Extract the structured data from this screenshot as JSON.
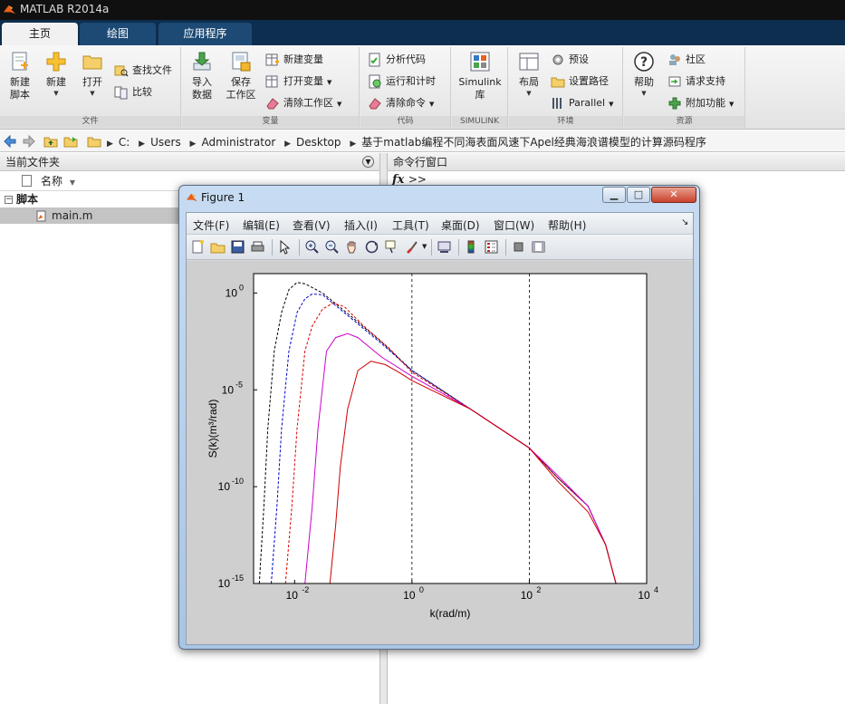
{
  "window": {
    "title": "MATLAB R2014a"
  },
  "tabs": [
    {
      "label": "主页",
      "active": true
    },
    {
      "label": "绘图",
      "active": false
    },
    {
      "label": "应用程序",
      "active": false
    }
  ],
  "ribbon": {
    "file": {
      "caption": "文件",
      "new_script": "新建\n脚本",
      "new_script_l1": "新建",
      "new_script_l2": "脚本",
      "new": "新建",
      "open": "打开",
      "find_files": "查找文件",
      "compare": "比较"
    },
    "variable": {
      "caption": "变量",
      "import_l1": "导入",
      "import_l2": "数据",
      "save_l1": "保存",
      "save_l2": "工作区",
      "new_variable": "新建变量",
      "open_variable": "打开变量",
      "clear_workspace": "清除工作区"
    },
    "code": {
      "caption": "代码",
      "analyze": "分析代码",
      "run_time": "运行和计时",
      "clear_commands": "清除命令"
    },
    "simulink": {
      "caption": "SIMULINK",
      "lib_l1": "Simulink",
      "lib_l2": "库"
    },
    "environment": {
      "caption": "环境",
      "layout": "布局",
      "preferences": "预设",
      "set_path": "设置路径",
      "parallel": "Parallel"
    },
    "resources": {
      "caption": "资源",
      "help": "帮助",
      "community": "社区",
      "support": "请求支持",
      "addons": "附加功能"
    }
  },
  "address": {
    "crumbs": [
      "C:",
      "Users",
      "Administrator",
      "Desktop",
      "基于matlab编程不同海表面风速下Apel经典海浪谱模型的计算源码程序"
    ]
  },
  "current_folder": {
    "title": "当前文件夹",
    "col_name": "名称",
    "group": "脚本",
    "file": "main.m"
  },
  "command_window": {
    "title": "命令行窗口",
    "prompt_fx": "fx",
    "prompt": ">>"
  },
  "figure": {
    "title": "Figure 1",
    "menu": [
      "文件(F)",
      "编辑(E)",
      "查看(V)",
      "插入(I)",
      "工具(T)",
      "桌面(D)",
      "窗口(W)",
      "帮助(H)"
    ]
  },
  "chart_data": {
    "type": "line",
    "title": "",
    "xlabel": "k(rad/m)",
    "ylabel": "S(k)(m³/rad)",
    "xscale": "log",
    "yscale": "log",
    "xlim": [
      0.002,
      10000
    ],
    "ylim": [
      1e-15,
      10
    ],
    "x_ticks": [
      {
        "v": 0.01,
        "label": "10",
        "exp": "-2"
      },
      {
        "v": 1,
        "label": "10",
        "exp": "0"
      },
      {
        "v": 100,
        "label": "10",
        "exp": "2"
      },
      {
        "v": 10000,
        "label": "10",
        "exp": "4"
      }
    ],
    "y_ticks": [
      {
        "v": 1e-15,
        "label": "10",
        "exp": "-15"
      },
      {
        "v": 1e-10,
        "label": "10",
        "exp": "-10"
      },
      {
        "v": 1e-05,
        "label": "10",
        "exp": "-5"
      },
      {
        "v": 1,
        "label": "10",
        "exp": "0"
      }
    ],
    "grid": "vertical dashed at x major ticks",
    "series": [
      {
        "color": "#000000",
        "style": "dashed",
        "points": [
          [
            0.0025,
            1e-15
          ],
          [
            0.003,
            1e-11
          ],
          [
            0.0035,
            1e-07
          ],
          [
            0.0045,
            0.001
          ],
          [
            0.006,
            0.1
          ],
          [
            0.008,
            1.5
          ],
          [
            0.011,
            3.5
          ],
          [
            0.015,
            3
          ],
          [
            0.03,
            1
          ],
          [
            0.1,
            0.05
          ],
          [
            0.3,
            0.003
          ],
          [
            1,
            0.0001
          ],
          [
            10,
            1e-06
          ],
          [
            100,
            1e-08
          ],
          [
            300,
            3e-10
          ],
          [
            1000,
            1e-11
          ],
          [
            2000,
            1e-13
          ],
          [
            3000,
            1e-15
          ]
        ]
      },
      {
        "color": "#0000cc",
        "style": "dashed",
        "points": [
          [
            0.004,
            1e-15
          ],
          [
            0.005,
            1e-11
          ],
          [
            0.006,
            1e-07
          ],
          [
            0.008,
            0.001
          ],
          [
            0.011,
            0.1
          ],
          [
            0.015,
            0.5
          ],
          [
            0.02,
            0.9
          ],
          [
            0.03,
            0.8
          ],
          [
            0.1,
            0.04
          ],
          [
            0.3,
            0.0025
          ],
          [
            1,
            0.0001
          ],
          [
            10,
            1e-06
          ],
          [
            100,
            1e-08
          ],
          [
            300,
            3e-10
          ],
          [
            1000,
            1e-11
          ],
          [
            2000,
            1e-13
          ],
          [
            3000,
            1e-15
          ]
        ]
      },
      {
        "color": "#dd0000",
        "style": "dashed",
        "points": [
          [
            0.007,
            1e-15
          ],
          [
            0.009,
            1e-11
          ],
          [
            0.011,
            1e-07
          ],
          [
            0.015,
            0.001
          ],
          [
            0.02,
            0.02
          ],
          [
            0.03,
            0.15
          ],
          [
            0.045,
            0.3
          ],
          [
            0.07,
            0.2
          ],
          [
            0.15,
            0.02
          ],
          [
            0.4,
            0.0015
          ],
          [
            1,
            8e-05
          ],
          [
            10,
            1e-06
          ],
          [
            100,
            1e-08
          ],
          [
            300,
            3e-10
          ],
          [
            1000,
            1e-11
          ],
          [
            2000,
            1e-13
          ],
          [
            3000,
            1e-15
          ]
        ]
      },
      {
        "color": "#cc00cc",
        "style": "solid",
        "points": [
          [
            0.015,
            1e-15
          ],
          [
            0.02,
            1e-11
          ],
          [
            0.025,
            1e-07
          ],
          [
            0.035,
            0.001
          ],
          [
            0.05,
            0.005
          ],
          [
            0.08,
            0.008
          ],
          [
            0.12,
            0.005
          ],
          [
            0.3,
            0.0005
          ],
          [
            1,
            5e-05
          ],
          [
            10,
            1e-06
          ],
          [
            100,
            1e-08
          ],
          [
            300,
            4e-10
          ],
          [
            1000,
            1e-11
          ],
          [
            2000,
            1e-13
          ],
          [
            3000,
            1e-15
          ]
        ]
      },
      {
        "color": "#cc0000",
        "style": "solid",
        "points": [
          [
            0.04,
            1e-15
          ],
          [
            0.05,
            1e-12
          ],
          [
            0.06,
            1e-09
          ],
          [
            0.08,
            1e-06
          ],
          [
            0.12,
            0.0001
          ],
          [
            0.2,
            0.0003
          ],
          [
            0.35,
            0.0002
          ],
          [
            0.6,
            8e-05
          ],
          [
            1,
            3e-05
          ],
          [
            10,
            1e-06
          ],
          [
            100,
            1e-08
          ],
          [
            300,
            2e-10
          ],
          [
            1000,
            5e-12
          ],
          [
            2000,
            1e-13
          ],
          [
            3000,
            1e-15
          ]
        ]
      }
    ]
  }
}
